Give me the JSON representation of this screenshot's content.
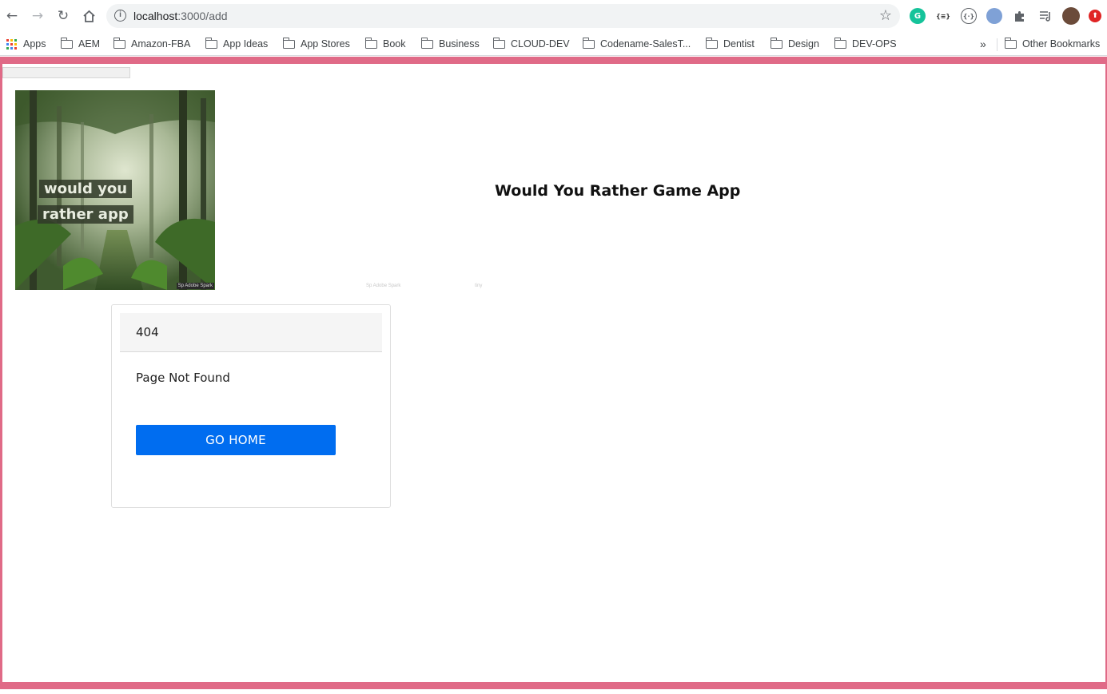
{
  "browser": {
    "url_host": "localhost",
    "url_path": ":3000/add",
    "bookmarks": [
      {
        "label": "Apps",
        "type": "apps"
      },
      {
        "label": "AEM",
        "type": "folder"
      },
      {
        "label": "Amazon-FBA",
        "type": "folder"
      },
      {
        "label": "App Ideas",
        "type": "folder"
      },
      {
        "label": "App Stores",
        "type": "folder"
      },
      {
        "label": "Book",
        "type": "folder"
      },
      {
        "label": "Business",
        "type": "folder"
      },
      {
        "label": "CLOUD-DEV",
        "type": "folder"
      },
      {
        "label": "Codename-SalesT...",
        "type": "folder"
      },
      {
        "label": "Dentist",
        "type": "folder"
      },
      {
        "label": "Design",
        "type": "folder"
      },
      {
        "label": "DEV-OPS",
        "type": "folder"
      }
    ],
    "overflow_label": "»",
    "other_bookmarks": "Other Bookmarks",
    "ext_grammarly": "G",
    "ext_json": "{≡}",
    "ext_code": "{·}",
    "ext_red": "⬆"
  },
  "page": {
    "frame_color": "#e06a87",
    "hero_line1": "would you",
    "hero_line2": "rather app",
    "hero_watermark": "Sp Adobe Spark",
    "app_title": "Would You Rather Game App",
    "faint_1": "Sp Adobe Spark",
    "faint_2": "tiny"
  },
  "card": {
    "header": "404",
    "message": "Page Not Found",
    "button_label": "GO HOME",
    "button_color": "#006df0"
  }
}
